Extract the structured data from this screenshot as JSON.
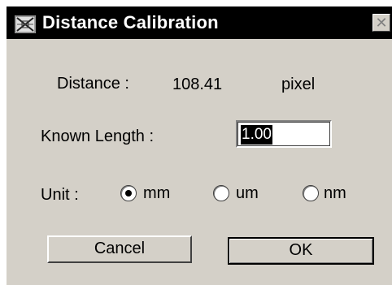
{
  "window": {
    "title": "Distance Calibration",
    "title_icon": "calibration-app-icon",
    "close_glyph": "✕"
  },
  "distance": {
    "label": "Distance :",
    "value": "108.41",
    "unit": "pixel"
  },
  "known_length": {
    "label": "Known Length :",
    "value": "1.00"
  },
  "unit": {
    "label": "Unit :",
    "options": [
      {
        "label": "mm",
        "selected": true
      },
      {
        "label": "um",
        "selected": false
      },
      {
        "label": "nm",
        "selected": false
      }
    ]
  },
  "buttons": {
    "cancel": "Cancel",
    "ok": "OK"
  },
  "colors": {
    "title_bar": "#000000",
    "dialog_bg": "#d4d0c8",
    "selection": "#000000"
  }
}
